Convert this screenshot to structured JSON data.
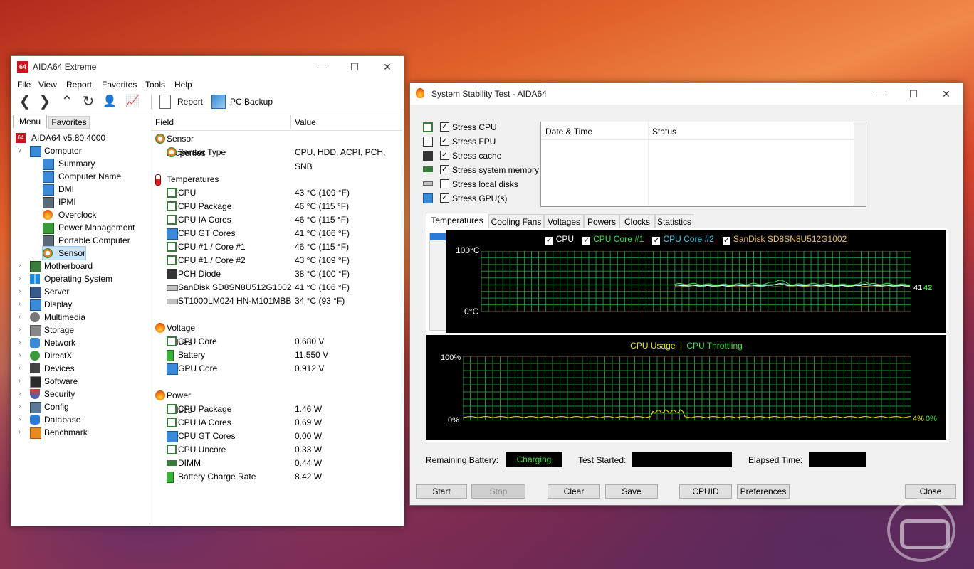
{
  "aida": {
    "title": "AIDA64 Extreme",
    "menu": [
      "File",
      "View",
      "Report",
      "Favorites",
      "Tools",
      "Help"
    ],
    "toolbar": {
      "report": "Report",
      "backup": "PC Backup"
    },
    "tabs": {
      "menu": "Menu",
      "favorites": "Favorites"
    },
    "root": "AIDA64 v5.80.4000",
    "computer": "Computer",
    "computer_children": [
      "Summary",
      "Computer Name",
      "DMI",
      "IPMI",
      "Overclock",
      "Power Management",
      "Portable Computer",
      "Sensor"
    ],
    "categories": [
      "Motherboard",
      "Operating System",
      "Server",
      "Display",
      "Multimedia",
      "Storage",
      "Network",
      "DirectX",
      "Devices",
      "Software",
      "Security",
      "Config",
      "Database",
      "Benchmark"
    ],
    "columns": {
      "field": "Field",
      "value": "Value"
    },
    "groups": {
      "sensor_props": "Sensor Properties",
      "temps": "Temperatures",
      "voltages": "Voltage Values",
      "power": "Power Values"
    },
    "sensor_type": {
      "field": "Sensor Type",
      "value": "CPU, HDD, ACPI, PCH, SNB"
    },
    "temps": [
      {
        "field": "CPU",
        "value": "43 °C  (109 °F)"
      },
      {
        "field": "CPU Package",
        "value": "46 °C  (115 °F)"
      },
      {
        "field": "CPU IA Cores",
        "value": "46 °C  (115 °F)"
      },
      {
        "field": "CPU GT Cores",
        "value": "41 °C  (106 °F)"
      },
      {
        "field": "CPU #1 / Core #1",
        "value": "46 °C  (115 °F)"
      },
      {
        "field": "CPU #1 / Core #2",
        "value": "43 °C  (109 °F)"
      },
      {
        "field": "PCH Diode",
        "value": "38 °C  (100 °F)"
      },
      {
        "field": "SanDisk SD8SN8U512G1002",
        "value": "41 °C  (106 °F)"
      },
      {
        "field": "ST1000LM024 HN-M101MBB",
        "value": "34 °C  (93 °F)"
      }
    ],
    "voltages": [
      {
        "field": "CPU Core",
        "value": "0.680 V"
      },
      {
        "field": "Battery",
        "value": "11.550 V"
      },
      {
        "field": "GPU Core",
        "value": "0.912 V"
      }
    ],
    "power": [
      {
        "field": "CPU Package",
        "value": "1.46 W"
      },
      {
        "field": "CPU IA Cores",
        "value": "0.69 W"
      },
      {
        "field": "CPU GT Cores",
        "value": "0.00 W"
      },
      {
        "field": "CPU Uncore",
        "value": "0.33 W"
      },
      {
        "field": "DIMM",
        "value": "0.44 W"
      },
      {
        "field": "Battery Charge Rate",
        "value": "8.42 W"
      }
    ]
  },
  "sst": {
    "title": "System Stability Test - AIDA64",
    "stress": [
      {
        "label": "Stress CPU",
        "checked": true
      },
      {
        "label": "Stress FPU",
        "checked": true
      },
      {
        "label": "Stress cache",
        "checked": true
      },
      {
        "label": "Stress system memory",
        "checked": true
      },
      {
        "label": "Stress local disks",
        "checked": false
      },
      {
        "label": "Stress GPU(s)",
        "checked": true
      }
    ],
    "log_columns": {
      "date": "Date & Time",
      "status": "Status"
    },
    "tabs": [
      "Temperatures",
      "Cooling Fans",
      "Voltages",
      "Powers",
      "Clocks",
      "Statistics"
    ],
    "temp_legend": [
      {
        "label": "CPU",
        "color": "#ffffff"
      },
      {
        "label": "CPU Core #1",
        "color": "#3ee03e"
      },
      {
        "label": "CPU Core #2",
        "color": "#3ec8e8"
      },
      {
        "label": "SanDisk SD8SN8U512G1002",
        "color": "#f0c060"
      }
    ],
    "temp_axis": {
      "top": "100°C",
      "bottom": "0°C"
    },
    "temp_readouts": {
      "a": "41",
      "b": "42"
    },
    "usage_legend": {
      "usage": "CPU Usage",
      "sep": "|",
      "throttle": "CPU Throttling"
    },
    "usage_axis": {
      "top": "100%",
      "bottom": "0%"
    },
    "usage_readouts": {
      "a": "4%",
      "b": "0%"
    },
    "status": {
      "battery_label": "Remaining Battery:",
      "battery_value": "Charging",
      "started_label": "Test Started:",
      "elapsed_label": "Elapsed Time:"
    },
    "buttons": {
      "start": "Start",
      "stop": "Stop",
      "clear": "Clear",
      "save": "Save",
      "cpuid": "CPUID",
      "prefs": "Preferences",
      "close": "Close"
    },
    "colors": {
      "grid": "#1f8f2f",
      "cpu": "#ffffff",
      "core1": "#3ee03e",
      "core2": "#3ec8e8",
      "disk": "#f0c060",
      "usage": "#e8e820",
      "throttle": "#3ee03e"
    }
  }
}
